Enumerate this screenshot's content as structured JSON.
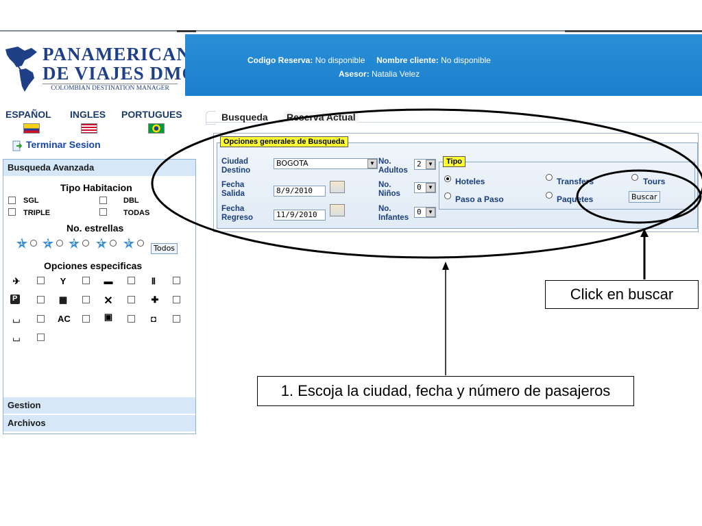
{
  "header": {
    "logo_line1": "PANAMERICANA",
    "logo_line2": "DE VIAJES DMC",
    "logo_subtitle": "COLOMBIAN DESTINATION MANAGER",
    "codigo_label": "Codigo Reserva:",
    "codigo_value": "No disponible",
    "cliente_label": "Nombre cliente:",
    "cliente_value": "No disponible",
    "asesor_label": "Asesor:",
    "asesor_value": "Natalia Velez"
  },
  "languages": [
    "ESPAÑOL",
    "INGLES",
    "PORTUGUES"
  ],
  "terminar_sesion": "Terminar Sesion",
  "sidebar": {
    "section1": "Busqueda Avanzada",
    "tipo_habitacion": "Tipo Habitacion",
    "room_types": [
      "SGL",
      "DBL",
      "TRIPLE",
      "TODAS"
    ],
    "estrellas": "No. estrellas",
    "star_numbers": [
      "1",
      "2",
      "3",
      "4",
      "5"
    ],
    "todos": "Todos",
    "opciones": "Opciones especificas",
    "ac_label": "AC",
    "section2": "Gestion",
    "section3": "Archivos"
  },
  "tabs": [
    "Busqueda",
    "Reserva Actual"
  ],
  "form": {
    "legend": "Opciones generales de Busqueda",
    "ciudad_label": [
      "Ciudad",
      "Destino"
    ],
    "ciudad_value": "BOGOTA",
    "fecha_salida_label": [
      "Fecha",
      "Salida"
    ],
    "fecha_salida_value": "8/9/2010",
    "fecha_regreso_label": [
      "Fecha",
      "Regreso"
    ],
    "fecha_regreso_value": "11/9/2010",
    "adultos_label": [
      "No.",
      "Adultos"
    ],
    "adultos_value": "2",
    "ninos_label": [
      "No.",
      "Niños"
    ],
    "ninos_value": "0",
    "infantes_label": [
      "No.",
      "Infantes"
    ],
    "infantes_value": "0",
    "tipo_legend": "Tipo",
    "tipo_options": [
      "Hoteles",
      "Transfers",
      "Tours",
      "Paso a Paso",
      "Paquetes"
    ],
    "tipo_selected": "Hoteles",
    "buscar": "Buscar"
  },
  "callouts": {
    "buscar": "Click en buscar",
    "step1": "1. Escoja la ciudad, fecha y número de pasajeros"
  },
  "colors": {
    "header_blue": "#1b7fcf",
    "logo_navy": "#1f3f86",
    "legend_yellow": "#ffff33",
    "sidebar_section": "#d6e8f8"
  }
}
